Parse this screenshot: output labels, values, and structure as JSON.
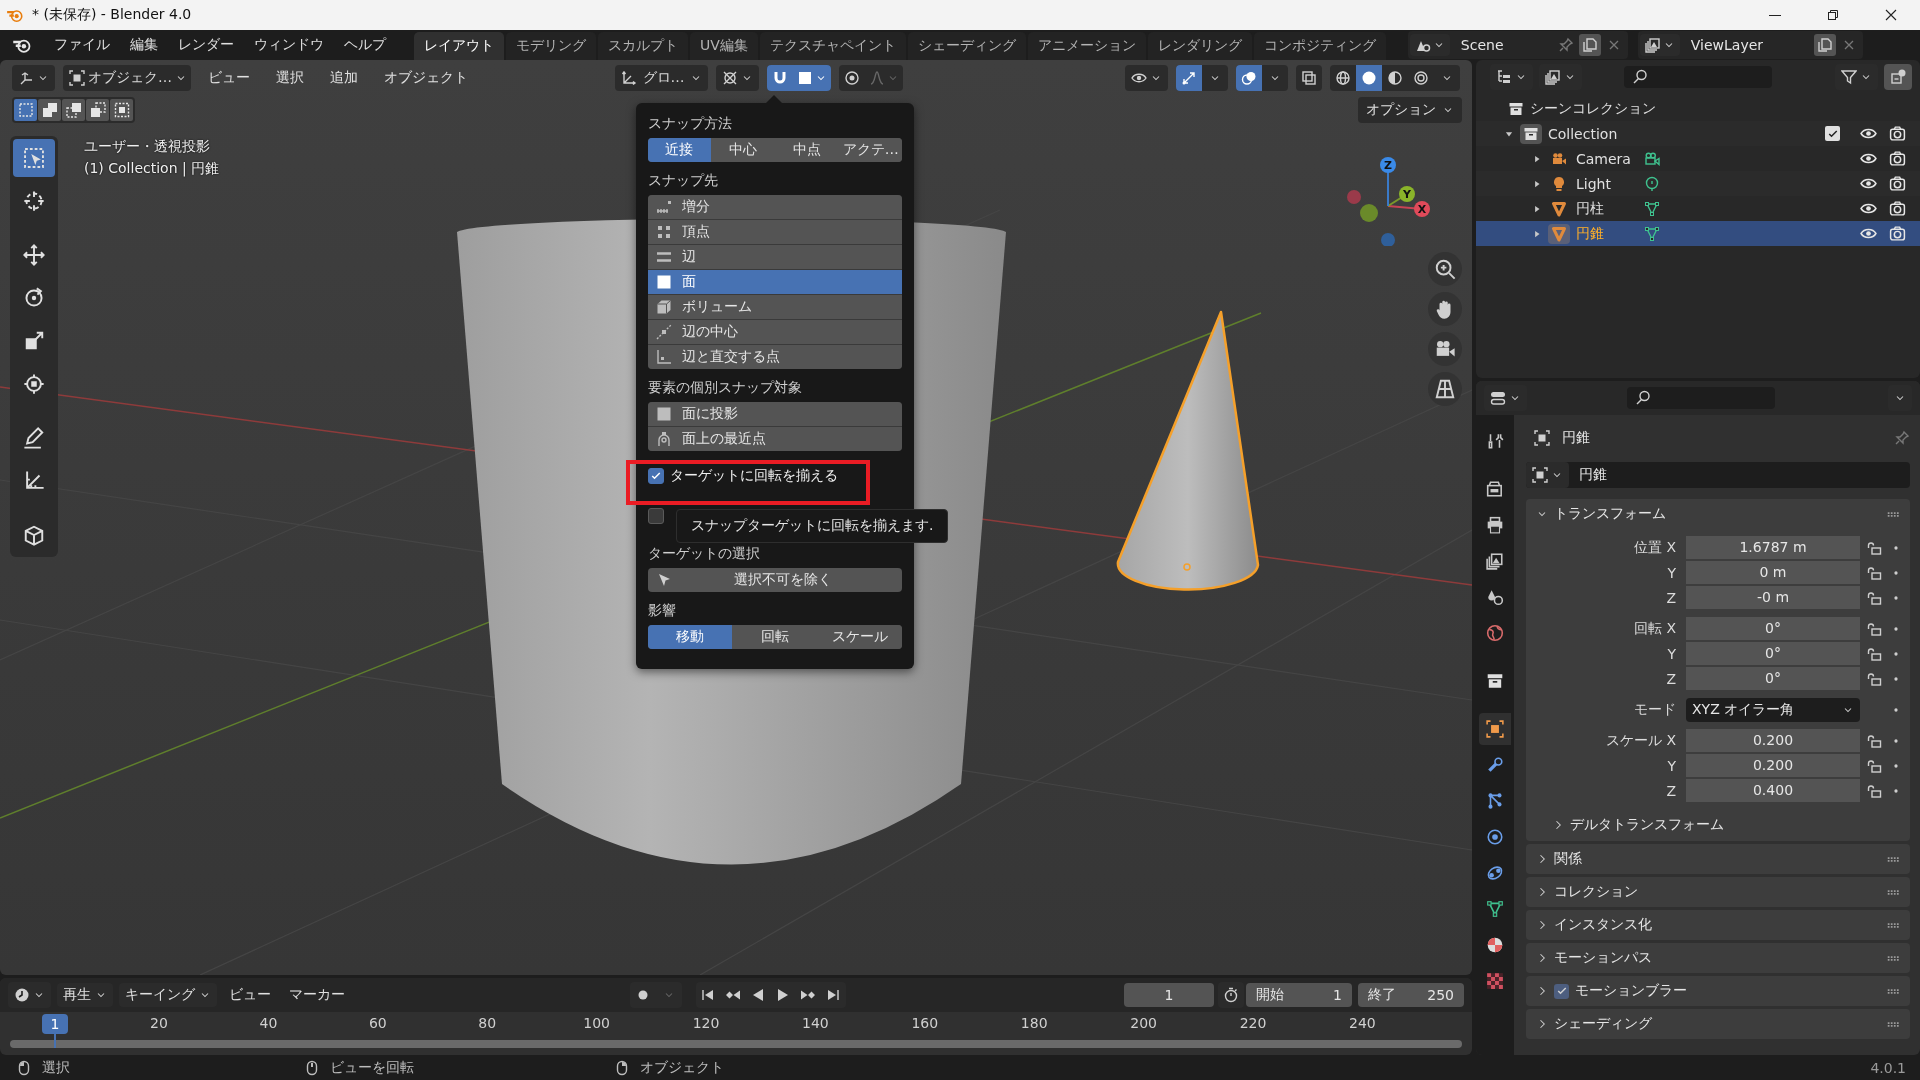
{
  "window": {
    "title": "* (未保存) - Blender 4.0"
  },
  "menu": [
    "ファイル",
    "編集",
    "レンダー",
    "ウィンドウ",
    "ヘルプ"
  ],
  "workspaces": [
    {
      "label": "レイアウト",
      "selected": true
    },
    {
      "label": "モデリング",
      "selected": false
    },
    {
      "label": "スカルプト",
      "selected": false
    },
    {
      "label": "UV編集",
      "selected": false
    },
    {
      "label": "テクスチャペイント",
      "selected": false
    },
    {
      "label": "シェーディング",
      "selected": false
    },
    {
      "label": "アニメーション",
      "selected": false
    },
    {
      "label": "レンダリング",
      "selected": false
    },
    {
      "label": "コンポジティング",
      "selected": false
    }
  ],
  "scene": "Scene",
  "view_layer": "ViewLayer",
  "viewport": {
    "mode": "オブジェク…",
    "menus": [
      "ビュー",
      "選択",
      "追加",
      "オブジェクト"
    ],
    "orientation": "グロ…",
    "snap_on": true,
    "proportional_on": false,
    "gizmos_on": true,
    "overlays_on": true,
    "xray_on": false,
    "shading": [
      {
        "selected": false
      },
      {
        "selected": true
      },
      {
        "selected": false
      },
      {
        "selected": false
      }
    ],
    "select_modes": [
      {
        "selected": true
      },
      {
        "selected": false
      },
      {
        "selected": false
      },
      {
        "selected": false
      },
      {
        "selected": false
      }
    ],
    "options": "オプション",
    "info": [
      "ユーザー・透視投影",
      "(1) Collection | 円錐"
    ],
    "tools": [
      {
        "selected": true
      },
      {
        "selected": false
      },
      {
        "selected": false
      },
      {
        "selected": false
      },
      {
        "selected": false
      },
      {
        "selected": false
      },
      {
        "selected": false
      },
      {
        "selected": false
      },
      {
        "selected": false
      }
    ],
    "gizmo_axes": [
      "X",
      "Y",
      "Z"
    ]
  },
  "snap_popup": {
    "method_title": "スナップ方法",
    "methods": [
      {
        "label": "近接",
        "selected": true
      },
      {
        "label": "中心",
        "selected": false
      },
      {
        "label": "中点",
        "selected": false
      },
      {
        "label": "アクテ…",
        "selected": false
      }
    ],
    "target_title": "スナップ先",
    "targets": [
      {
        "label": "増分",
        "selected": false
      },
      {
        "label": "頂点",
        "selected": false
      },
      {
        "label": "辺",
        "selected": false
      },
      {
        "label": "面",
        "selected": true
      },
      {
        "label": "ボリューム",
        "selected": false
      },
      {
        "label": "辺の中心",
        "selected": false
      },
      {
        "label": "辺と直交する点",
        "selected": false
      }
    ],
    "individual_title": "要素の個別スナップ対象",
    "individual": [
      {
        "label": "面に投影",
        "selected": false
      },
      {
        "label": "面上の最近点",
        "selected": false
      }
    ],
    "align_rotation": {
      "label": "ターゲットに回転を揃える",
      "checked": true
    },
    "second_checkbox": {
      "checked": false
    },
    "tooltip": "スナップターゲットに回転を揃えます.",
    "selection_title": "ターゲットの選択",
    "exclude_button": "選択不可を除く",
    "affect_title": "影響",
    "affect": [
      {
        "label": "移動",
        "selected": true
      },
      {
        "label": "回転",
        "selected": false
      },
      {
        "label": "スケール",
        "selected": false
      }
    ]
  },
  "outliner": {
    "root": "シーンコレクション",
    "items": [
      {
        "name": "Collection",
        "kind": "collection",
        "expanded": true,
        "checked": true,
        "selected": false,
        "children": [
          {
            "name": "Camera",
            "kind": "camera",
            "expanded": false,
            "selected": false
          },
          {
            "name": "Light",
            "kind": "light",
            "expanded": false,
            "selected": false
          },
          {
            "name": "円柱",
            "kind": "mesh",
            "expanded": false,
            "selected": false
          },
          {
            "name": "円錐",
            "kind": "mesh",
            "expanded": false,
            "selected": true
          }
        ]
      }
    ]
  },
  "properties": {
    "tabs": [
      {
        "selected": false
      },
      {
        "selected": false
      },
      {
        "selected": false
      },
      {
        "selected": false
      },
      {
        "selected": false
      },
      {
        "selected": false
      },
      {
        "selected": false
      },
      {
        "selected": true
      },
      {
        "selected": false
      },
      {
        "selected": false
      },
      {
        "selected": false
      },
      {
        "selected": false
      },
      {
        "selected": false
      },
      {
        "selected": false
      },
      {
        "selected": false
      }
    ],
    "object_name": "円錐",
    "name_field": "円錐",
    "transform": {
      "title": "トランスフォーム",
      "expanded": true,
      "groups": [
        {
          "rows": [
            {
              "label": "位置 X",
              "value": "1.6787 m",
              "kind": "number"
            },
            {
              "label": "Y",
              "value": "0 m",
              "kind": "number"
            },
            {
              "label": "Z",
              "value": "-0 m",
              "kind": "number"
            }
          ]
        },
        {
          "rows": [
            {
              "label": "回転 X",
              "value": "0°",
              "kind": "number"
            },
            {
              "label": "Y",
              "value": "0°",
              "kind": "number"
            },
            {
              "label": "Z",
              "value": "0°",
              "kind": "number"
            }
          ]
        },
        {
          "rows": [
            {
              "label": "モード",
              "value": "XYZ オイラー角",
              "kind": "dropdown"
            }
          ]
        },
        {
          "rows": [
            {
              "label": "スケール X",
              "value": "0.200",
              "kind": "number"
            },
            {
              "label": "Y",
              "value": "0.200",
              "kind": "number"
            },
            {
              "label": "Z",
              "value": "0.400",
              "kind": "number"
            }
          ]
        }
      ],
      "subpanel": {
        "title": "デルタトランスフォーム",
        "expanded": false
      }
    },
    "panels": [
      {
        "title": "関係",
        "kind": "plain",
        "expanded": false
      },
      {
        "title": "コレクション",
        "kind": "plain",
        "expanded": false
      },
      {
        "title": "インスタンス化",
        "kind": "plain",
        "expanded": false
      },
      {
        "title": "モーションパス",
        "kind": "plain",
        "expanded": false
      },
      {
        "title": "モーションブラー",
        "kind": "toggle",
        "checked": true,
        "expanded": false
      },
      {
        "title": "シェーディング",
        "kind": "plain",
        "expanded": false
      }
    ]
  },
  "timeline": {
    "menus": [
      {
        "label": "再生",
        "dropdown": true
      },
      {
        "label": "キーイング",
        "dropdown": true
      },
      {
        "label": "ビュー",
        "dropdown": false
      },
      {
        "label": "マーカー",
        "dropdown": false
      }
    ],
    "current_frame": "1",
    "start_label": "開始",
    "start": "1",
    "end_label": "終了",
    "end": "250",
    "ruler_current": "1",
    "ruler_ticks": [
      "20",
      "40",
      "60",
      "80",
      "100",
      "120",
      "140",
      "160",
      "180",
      "200",
      "220",
      "240"
    ]
  },
  "status_bar": {
    "hints": [
      "選択",
      "ビューを回転",
      "オブジェクト"
    ],
    "version": "4.0.1"
  }
}
